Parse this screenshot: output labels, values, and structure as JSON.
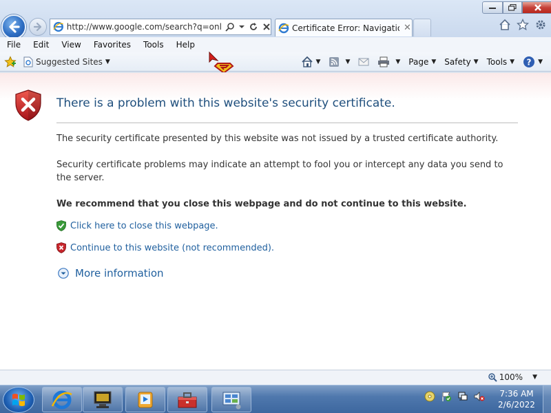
{
  "window": {
    "address_url": "http://www.google.com/search?q=online+",
    "tab_title": "Certificate Error: Navigatio...",
    "close_symbol": "✕"
  },
  "menu": [
    "File",
    "Edit",
    "View",
    "Favorites",
    "Tools",
    "Help"
  ],
  "favorites_bar": {
    "suggested_sites": "Suggested Sites"
  },
  "command_bar": {
    "page": "Page",
    "safety": "Safety",
    "tools": "Tools"
  },
  "error_page": {
    "title": "There is a problem with this website's security certificate.",
    "para1": "The security certificate presented by this website was not issued by a trusted certificate authority.",
    "para2": "Security certificate problems may indicate an attempt to fool you or intercept any data you send to the server.",
    "recommend": "We recommend that you close this webpage and do not continue to this website.",
    "close_link": "Click here to close this webpage.",
    "continue_link": "Continue to this website (not recommended).",
    "more_info": "More information"
  },
  "status_bar": {
    "zoom": "100%"
  },
  "taskbar": {
    "time": "7:36 AM",
    "date": "2/6/2022"
  },
  "colors": {
    "link": "#1f5f9e",
    "title": "#1f4f7d",
    "error_red": "#c8262c",
    "ok_green": "#3a9a3a"
  },
  "icons": [
    "back-icon",
    "forward-icon",
    "ie-icon",
    "search-icon",
    "refresh-icon",
    "stop-icon",
    "home-icon",
    "star-icon",
    "gear-icon",
    "feeds-icon",
    "mail-icon",
    "print-icon",
    "help-icon",
    "shield-x-icon",
    "shield-check-icon",
    "chevron-down-icon",
    "zoom-icon"
  ]
}
